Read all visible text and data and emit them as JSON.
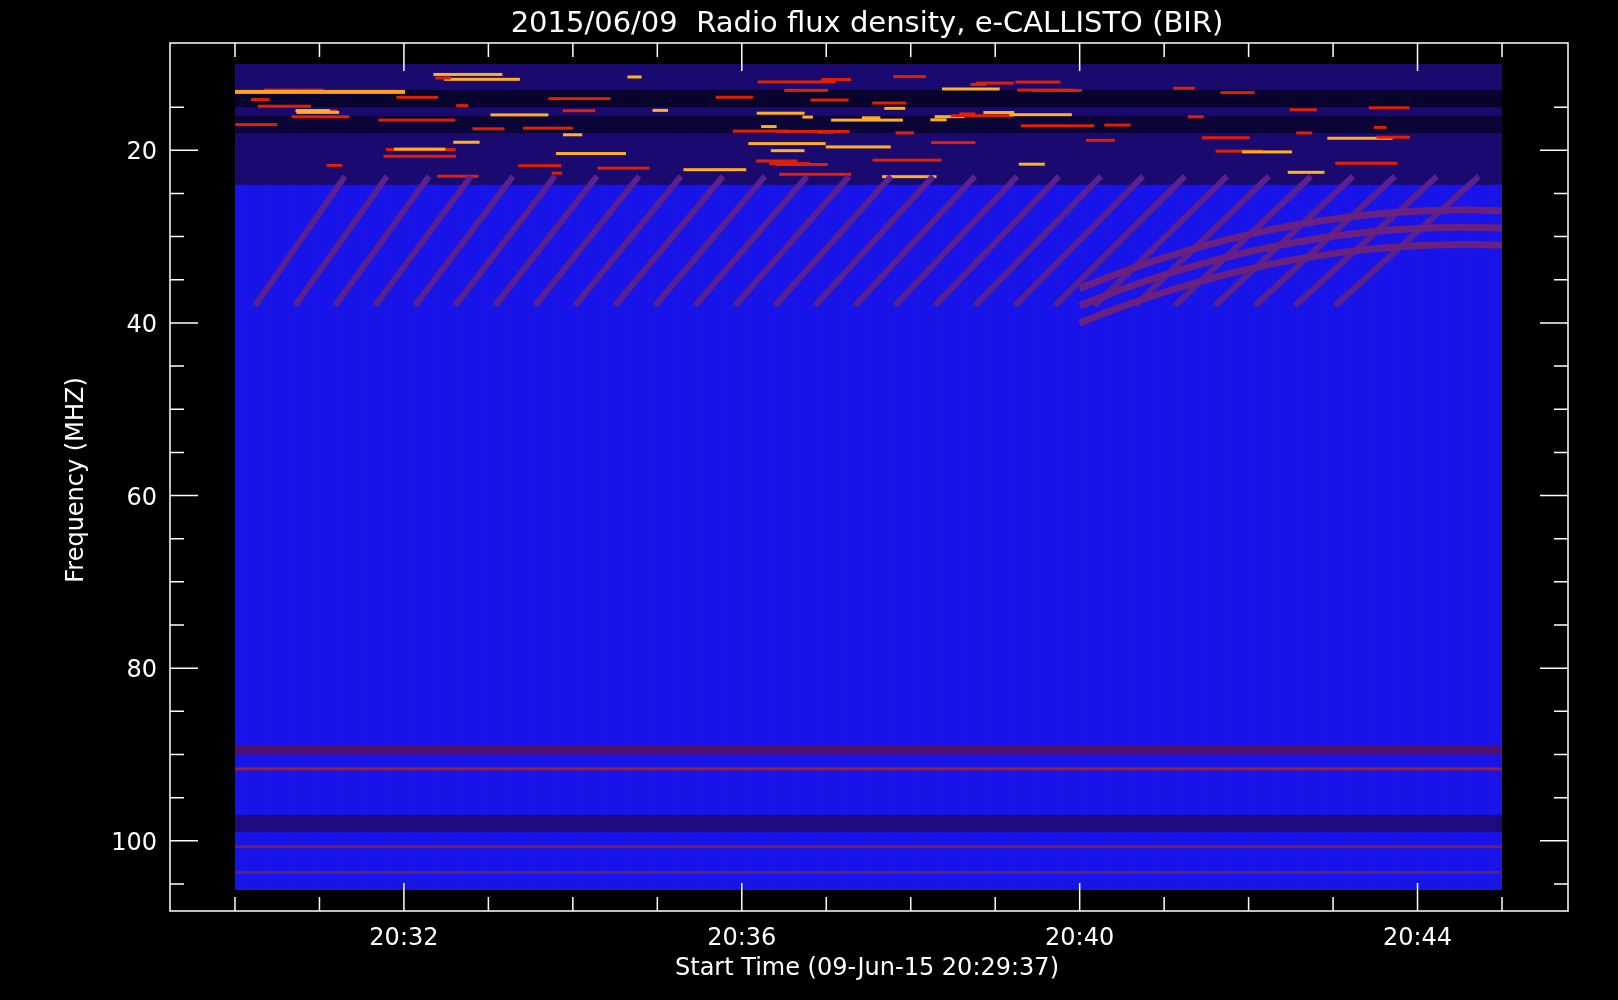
{
  "plot": {
    "title": "2015/06/09  Radio flux density, e-CALLISTO (BIR)",
    "xlabel": "Start Time (09-Jun-15 20:29:37)",
    "ylabel": "Frequency (MHZ)",
    "yticks": [
      "20",
      "40",
      "60",
      "80",
      "100"
    ],
    "xticks": [
      "20:32",
      "20:36",
      "20:40",
      "20:44"
    ]
  }
}
